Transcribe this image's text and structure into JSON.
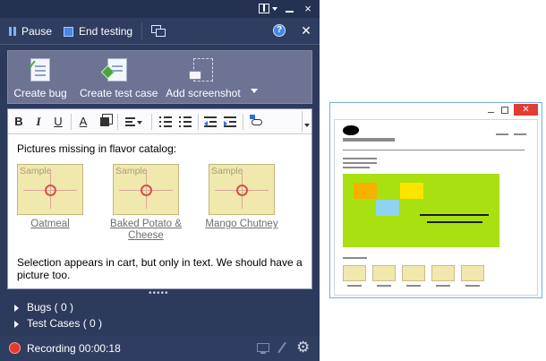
{
  "runner": {
    "toolbar": {
      "pause_label": "Pause",
      "end_testing_label": "End testing"
    },
    "actions": {
      "create_bug_label": "Create bug",
      "create_test_case_label": "Create test case",
      "add_screenshot_label": "Add screenshot"
    },
    "formatting_buttons": {
      "bold": "B",
      "italic": "I",
      "underline": "U",
      "font_color": "A"
    },
    "notes": {
      "heading": "Pictures missing in flavor catalog:",
      "thumbnail_caption": "Sample",
      "items": [
        {
          "label": "Oatmeal"
        },
        {
          "label": "Baked Potato & Cheese"
        },
        {
          "label": "Mango Chutney"
        }
      ],
      "body": "Selection appears in cart, but only in text. We should have a picture too."
    },
    "sections": {
      "bugs_label": "Bugs ( 0 )",
      "test_cases_label": "Test Cases ( 0 )"
    },
    "status": {
      "recording_text": "Recording 00:00:18"
    },
    "icons": {
      "window_close": "×",
      "toolbar_close": "✕",
      "help": "?",
      "settings": "⚙",
      "grip": "•••••"
    },
    "colors": {
      "panel_background": "#2c3a5c",
      "recording_dot": "#e33a2c",
      "thumbnail_fill": "#f0e8ad"
    }
  },
  "browser_mockup": {
    "close_glyph": "✕",
    "colors": {
      "hero": "#a9e011",
      "box_orange": "#f7b100",
      "box_yellow": "#fde500",
      "box_blue": "#8fd3ee",
      "window_close": "#e23c33"
    }
  }
}
